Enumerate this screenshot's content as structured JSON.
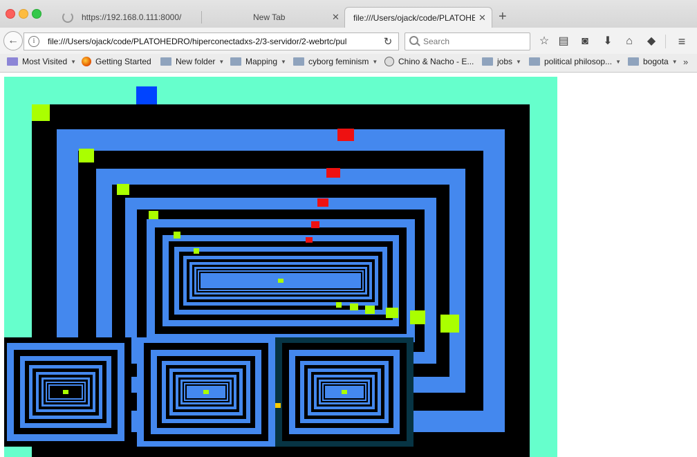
{
  "window": {
    "tabs": [
      {
        "title": "https://192.168.0.111:8000/",
        "active": false
      },
      {
        "title": "New Tab",
        "active": false
      },
      {
        "title": "file:///Users/ojack/code/PLATOHED",
        "active": true
      }
    ],
    "new_tab_label": "+"
  },
  "navbar": {
    "url": "file:///Users/ojack/code/PLATOHEDRO/hiperconectadxs-2/3-servidor/2-webrtc/pul",
    "search_placeholder": "Search"
  },
  "bookmarks": [
    {
      "label": "Most Visited",
      "icon": "star-folder-icon",
      "dropdown": true
    },
    {
      "label": "Getting Started",
      "icon": "firefox-icon",
      "dropdown": false
    },
    {
      "label": "New folder",
      "icon": "folder-icon",
      "dropdown": true
    },
    {
      "label": "Mapping",
      "icon": "folder-icon",
      "dropdown": true
    },
    {
      "label": "cyborg feminism",
      "icon": "folder-icon",
      "dropdown": true
    },
    {
      "label": "Chino & Nacho - E...",
      "icon": "globe-icon",
      "dropdown": false
    },
    {
      "label": "jobs",
      "icon": "folder-icon",
      "dropdown": true
    },
    {
      "label": "political philosop...",
      "icon": "folder-icon",
      "dropdown": true
    },
    {
      "label": "bogota",
      "icon": "folder-icon",
      "dropdown": true
    }
  ],
  "colors": {
    "canvas_bg": "#66ffcc",
    "frame_blue": "#4488ee",
    "frame_black": "#000000",
    "accent_lime": "#aaff00",
    "accent_red": "#ee1111",
    "accent_blue": "#0044ff",
    "thumb_border_dark": "#073444"
  }
}
